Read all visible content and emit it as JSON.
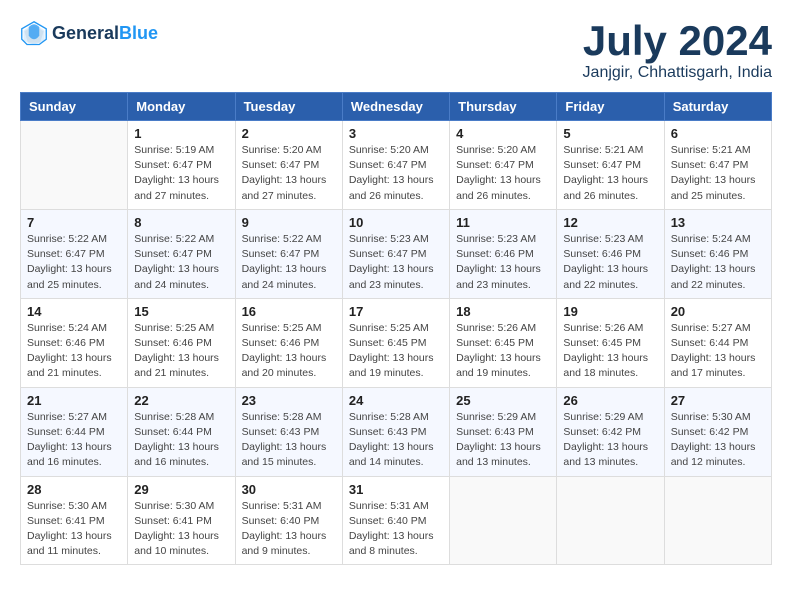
{
  "logo": {
    "name1": "General",
    "name2": "Blue"
  },
  "title": {
    "month": "July 2024",
    "location": "Janjgir, Chhattisgarh, India"
  },
  "headers": [
    "Sunday",
    "Monday",
    "Tuesday",
    "Wednesday",
    "Thursday",
    "Friday",
    "Saturday"
  ],
  "weeks": [
    [
      {
        "day": "",
        "info": ""
      },
      {
        "day": "1",
        "info": "Sunrise: 5:19 AM\nSunset: 6:47 PM\nDaylight: 13 hours\nand 27 minutes."
      },
      {
        "day": "2",
        "info": "Sunrise: 5:20 AM\nSunset: 6:47 PM\nDaylight: 13 hours\nand 27 minutes."
      },
      {
        "day": "3",
        "info": "Sunrise: 5:20 AM\nSunset: 6:47 PM\nDaylight: 13 hours\nand 26 minutes."
      },
      {
        "day": "4",
        "info": "Sunrise: 5:20 AM\nSunset: 6:47 PM\nDaylight: 13 hours\nand 26 minutes."
      },
      {
        "day": "5",
        "info": "Sunrise: 5:21 AM\nSunset: 6:47 PM\nDaylight: 13 hours\nand 26 minutes."
      },
      {
        "day": "6",
        "info": "Sunrise: 5:21 AM\nSunset: 6:47 PM\nDaylight: 13 hours\nand 25 minutes."
      }
    ],
    [
      {
        "day": "7",
        "info": "Sunrise: 5:22 AM\nSunset: 6:47 PM\nDaylight: 13 hours\nand 25 minutes."
      },
      {
        "day": "8",
        "info": "Sunrise: 5:22 AM\nSunset: 6:47 PM\nDaylight: 13 hours\nand 24 minutes."
      },
      {
        "day": "9",
        "info": "Sunrise: 5:22 AM\nSunset: 6:47 PM\nDaylight: 13 hours\nand 24 minutes."
      },
      {
        "day": "10",
        "info": "Sunrise: 5:23 AM\nSunset: 6:47 PM\nDaylight: 13 hours\nand 23 minutes."
      },
      {
        "day": "11",
        "info": "Sunrise: 5:23 AM\nSunset: 6:46 PM\nDaylight: 13 hours\nand 23 minutes."
      },
      {
        "day": "12",
        "info": "Sunrise: 5:23 AM\nSunset: 6:46 PM\nDaylight: 13 hours\nand 22 minutes."
      },
      {
        "day": "13",
        "info": "Sunrise: 5:24 AM\nSunset: 6:46 PM\nDaylight: 13 hours\nand 22 minutes."
      }
    ],
    [
      {
        "day": "14",
        "info": "Sunrise: 5:24 AM\nSunset: 6:46 PM\nDaylight: 13 hours\nand 21 minutes."
      },
      {
        "day": "15",
        "info": "Sunrise: 5:25 AM\nSunset: 6:46 PM\nDaylight: 13 hours\nand 21 minutes."
      },
      {
        "day": "16",
        "info": "Sunrise: 5:25 AM\nSunset: 6:46 PM\nDaylight: 13 hours\nand 20 minutes."
      },
      {
        "day": "17",
        "info": "Sunrise: 5:25 AM\nSunset: 6:45 PM\nDaylight: 13 hours\nand 19 minutes."
      },
      {
        "day": "18",
        "info": "Sunrise: 5:26 AM\nSunset: 6:45 PM\nDaylight: 13 hours\nand 19 minutes."
      },
      {
        "day": "19",
        "info": "Sunrise: 5:26 AM\nSunset: 6:45 PM\nDaylight: 13 hours\nand 18 minutes."
      },
      {
        "day": "20",
        "info": "Sunrise: 5:27 AM\nSunset: 6:44 PM\nDaylight: 13 hours\nand 17 minutes."
      }
    ],
    [
      {
        "day": "21",
        "info": "Sunrise: 5:27 AM\nSunset: 6:44 PM\nDaylight: 13 hours\nand 16 minutes."
      },
      {
        "day": "22",
        "info": "Sunrise: 5:28 AM\nSunset: 6:44 PM\nDaylight: 13 hours\nand 16 minutes."
      },
      {
        "day": "23",
        "info": "Sunrise: 5:28 AM\nSunset: 6:43 PM\nDaylight: 13 hours\nand 15 minutes."
      },
      {
        "day": "24",
        "info": "Sunrise: 5:28 AM\nSunset: 6:43 PM\nDaylight: 13 hours\nand 14 minutes."
      },
      {
        "day": "25",
        "info": "Sunrise: 5:29 AM\nSunset: 6:43 PM\nDaylight: 13 hours\nand 13 minutes."
      },
      {
        "day": "26",
        "info": "Sunrise: 5:29 AM\nSunset: 6:42 PM\nDaylight: 13 hours\nand 13 minutes."
      },
      {
        "day": "27",
        "info": "Sunrise: 5:30 AM\nSunset: 6:42 PM\nDaylight: 13 hours\nand 12 minutes."
      }
    ],
    [
      {
        "day": "28",
        "info": "Sunrise: 5:30 AM\nSunset: 6:41 PM\nDaylight: 13 hours\nand 11 minutes."
      },
      {
        "day": "29",
        "info": "Sunrise: 5:30 AM\nSunset: 6:41 PM\nDaylight: 13 hours\nand 10 minutes."
      },
      {
        "day": "30",
        "info": "Sunrise: 5:31 AM\nSunset: 6:40 PM\nDaylight: 13 hours\nand 9 minutes."
      },
      {
        "day": "31",
        "info": "Sunrise: 5:31 AM\nSunset: 6:40 PM\nDaylight: 13 hours\nand 8 minutes."
      },
      {
        "day": "",
        "info": ""
      },
      {
        "day": "",
        "info": ""
      },
      {
        "day": "",
        "info": ""
      }
    ]
  ]
}
